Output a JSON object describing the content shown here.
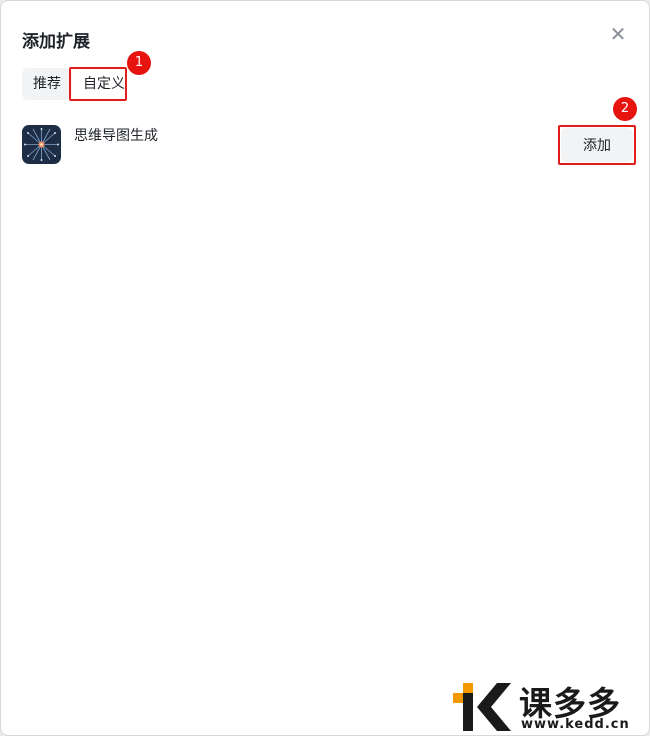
{
  "dialog": {
    "title": "添加扩展",
    "close_symbol": "✕"
  },
  "tabs": [
    {
      "label": "推荐",
      "active": false
    },
    {
      "label": "自定义",
      "active": true
    }
  ],
  "extensions": [
    {
      "name": "思维导图生成",
      "icon": "mind-map-icon",
      "add_label": "添加"
    }
  ],
  "annotations": {
    "badge_1": "1",
    "badge_2": "2",
    "color": "#e21b1b"
  },
  "watermark": {
    "name": "课多多",
    "url": "www.kedd.cn"
  },
  "colors": {
    "text": "#1f2329",
    "button_bg": "#f2f3f5",
    "icon_bg": "#1c2d45",
    "logo_orange": "#f39800"
  }
}
